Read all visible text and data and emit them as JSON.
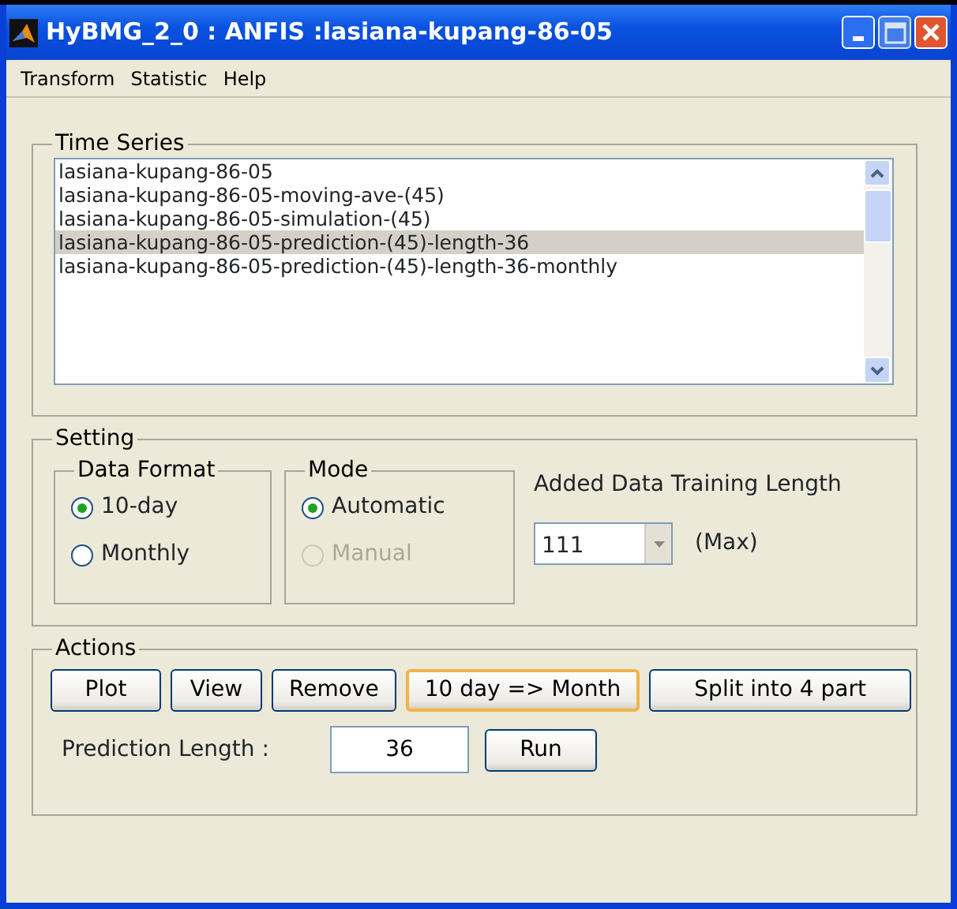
{
  "window": {
    "title": "HyBMG_2_0 : ANFIS :lasiana-kupang-86-05"
  },
  "menu": [
    "Transform",
    "Statistic",
    "Help"
  ],
  "time_series": {
    "label": "Time Series",
    "items": [
      {
        "text": "lasiana-kupang-86-05",
        "selected": false
      },
      {
        "text": "lasiana-kupang-86-05-moving-ave-(45)",
        "selected": false
      },
      {
        "text": "lasiana-kupang-86-05-simulation-(45)",
        "selected": false
      },
      {
        "text": "lasiana-kupang-86-05-prediction-(45)-length-36",
        "selected": true
      },
      {
        "text": "lasiana-kupang-86-05-prediction-(45)-length-36-monthly",
        "selected": false
      }
    ]
  },
  "setting": {
    "label": "Setting",
    "data_format": {
      "label": "Data Format",
      "options": [
        {
          "label": "10-day",
          "selected": true,
          "disabled": false
        },
        {
          "label": "Monthly",
          "selected": false,
          "disabled": false
        }
      ]
    },
    "mode": {
      "label": "Mode",
      "options": [
        {
          "label": "Automatic",
          "selected": true,
          "disabled": false
        },
        {
          "label": "Manual",
          "selected": false,
          "disabled": true
        }
      ]
    },
    "training": {
      "label": "Added Data Training Length",
      "value": "111",
      "note": "(Max)"
    }
  },
  "actions": {
    "label": "Actions",
    "buttons": [
      {
        "label": "Plot",
        "focused": false
      },
      {
        "label": "View",
        "focused": false
      },
      {
        "label": "Remove",
        "focused": false
      },
      {
        "label": "10 day => Month",
        "focused": true
      },
      {
        "label": "Split into 4 part",
        "focused": false
      }
    ],
    "prediction_label": "Prediction Length :",
    "prediction_value": "36",
    "run": "Run"
  }
}
